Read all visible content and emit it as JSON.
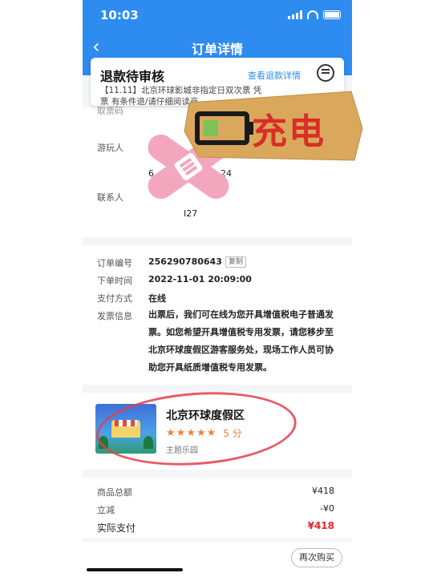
{
  "status_bar": {
    "time": "10:03"
  },
  "header": {
    "back_icon": "chevron-left-icon",
    "title": "订单详情"
  },
  "refund": {
    "title": "退款待审核",
    "link": "查看退款详情",
    "desc_line1": "【11.11】北京环球影城非指定日双次票 凭",
    "desc_line2": "票 有条件退/请仔细阅读商",
    "icon": "chat-icon"
  },
  "visitor": {
    "cut_label": "取票码",
    "visitor_label": "游玩人",
    "visitor_value_fragment": "6",
    "id_fragment": "24",
    "contact_label": "联系人",
    "phone_fragment": "I27"
  },
  "order": {
    "number_label": "订单编号",
    "number_value": "256290780643",
    "copy_label": "复制",
    "time_label": "下单时间",
    "time_value": "2022-11-01 20:09:00",
    "pay_method_label": "支付方式",
    "pay_method_value": "在线",
    "invoice_label": "发票信息",
    "invoice_text": "出票后，我们可在线为您开具增值税电子普通发票。如您希望开具增值税专用发票，请您移步至北京环球度假区游客服务处，现场工作人员可协助您开具纸质增值税专用发票。"
  },
  "park": {
    "name": "北京环球度假区",
    "rating": 5,
    "score_label": "5 分",
    "type": "主题乐园"
  },
  "payment": {
    "total_label": "商品总额",
    "total_value": "¥418",
    "discount_label": "立减",
    "discount_value": "-¥0",
    "actual_label": "实际支付",
    "actual_value": "¥418"
  },
  "footer": {
    "rebuy_label": "再次购买"
  },
  "stickers": {
    "charge_text": "充电"
  },
  "colors": {
    "primary": "#2e8cf0",
    "price_red": "#e0282d",
    "star_orange": "#f0823a",
    "ring_red": "#e0404d",
    "bandage_pink": "#f3a7be",
    "kraft": "#d9a85c"
  }
}
